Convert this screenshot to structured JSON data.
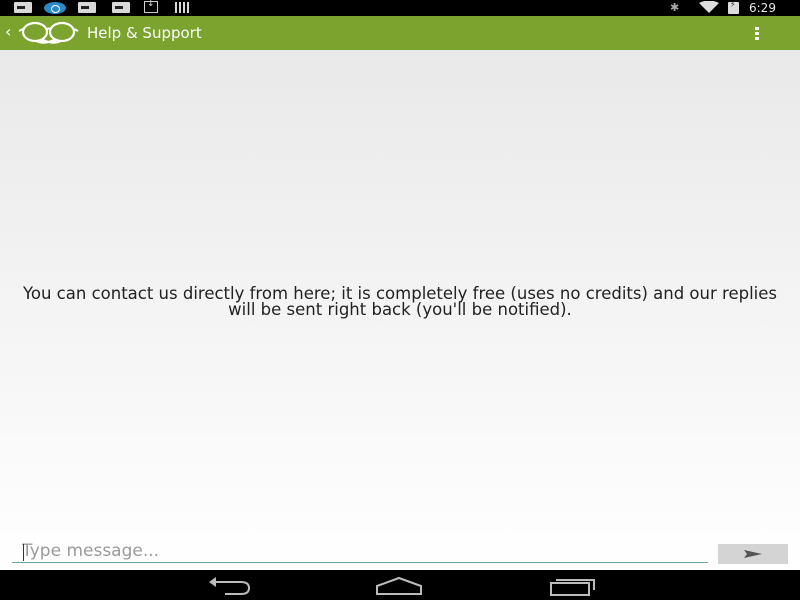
{
  "status_bar": {
    "time": "6:29",
    "icons": [
      "notification-icon",
      "sync-icon",
      "notification-icon",
      "notification-icon",
      "download-icon",
      "barcode-icon",
      "bluetooth-icon",
      "wifi-icon",
      "battery-charging-icon"
    ]
  },
  "action_bar": {
    "title": "Help & Support",
    "background_color": "#7ba32e",
    "icons": [
      "back-arrow-icon",
      "app-logo",
      "overflow-menu-icon"
    ]
  },
  "content": {
    "info_text": "You can contact us directly from here; it is completely free (uses no credits) and our replies will be sent right back (you'll be notified)."
  },
  "compose": {
    "placeholder": "Type message...",
    "value": "",
    "send_icon": "send-icon"
  },
  "nav_bar": {
    "buttons": [
      "back-icon",
      "home-icon",
      "recents-icon"
    ]
  }
}
